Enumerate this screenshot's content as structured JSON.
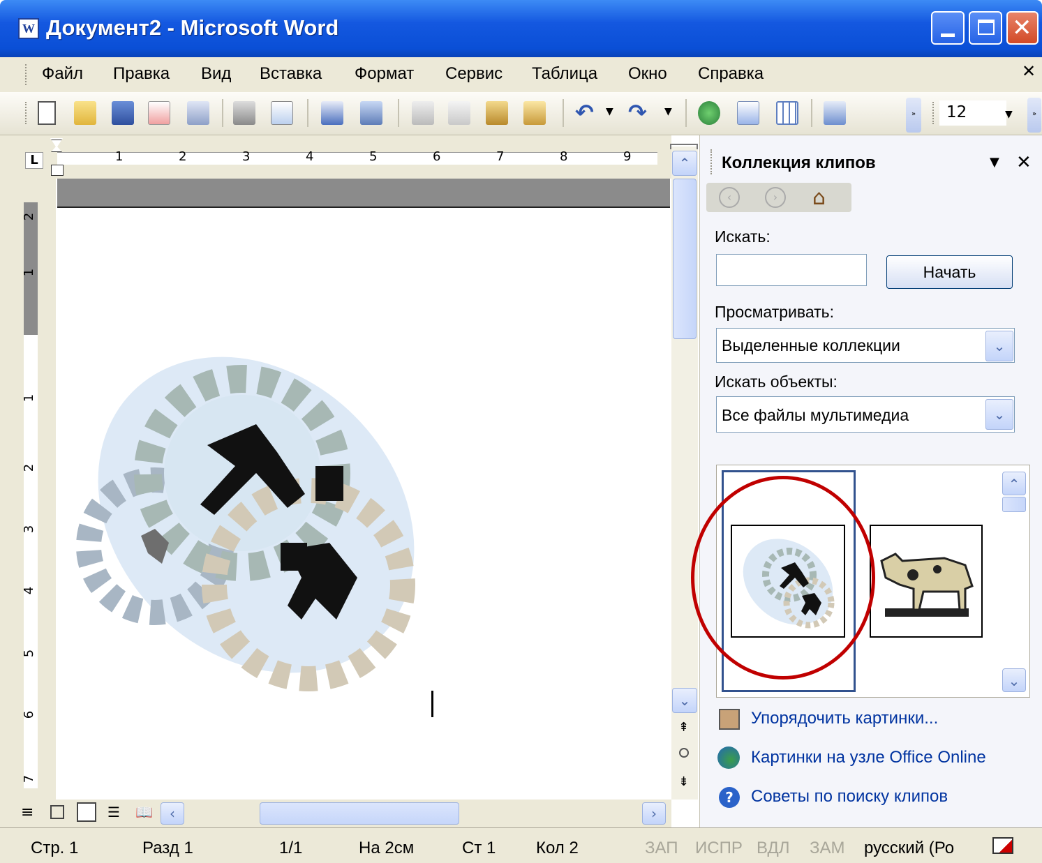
{
  "window": {
    "title": "Документ2 - Microsoft Word",
    "app_icon": "W"
  },
  "menu": {
    "items": [
      "Файл",
      "Правка",
      "Вид",
      "Вставка",
      "Формат",
      "Сервис",
      "Таблица",
      "Окно",
      "Справка"
    ],
    "close_glyph": "✕"
  },
  "toolbar": {
    "font_size": "12"
  },
  "ruler": {
    "h_numbers": [
      "1",
      "2",
      "3",
      "4",
      "5",
      "6",
      "7",
      "8",
      "9"
    ],
    "v_numbers": [
      "2",
      "1",
      "1",
      "2",
      "3",
      "4",
      "5",
      "6",
      "7"
    ],
    "tab_marker": "L"
  },
  "pane": {
    "title": "Коллекция клипов",
    "search_label": "Искать:",
    "search_value": "",
    "start_button": "Начать",
    "browse_label": "Просматривать:",
    "browse_value": "Выделенные коллекции",
    "types_label": "Искать объекты:",
    "types_value": "Все файлы мультимедиа",
    "links": [
      "Упорядочить картинки...",
      "Картинки на узле Office Online",
      "Советы по поиску клипов"
    ]
  },
  "status": {
    "page": "Стр. 1",
    "section": "Разд 1",
    "pages": "1/1",
    "at": "На 2см",
    "line": "Ст 1",
    "col": "Кол 2",
    "rec": "ЗАП",
    "trk": "ИСПР",
    "ext": "ВДЛ",
    "ovr": "ЗАМ",
    "lang": "русский (Ро"
  },
  "colors": {
    "title_blue": "#0a4fd6",
    "highlight_circle": "#c00000",
    "link": "#0033a0"
  }
}
